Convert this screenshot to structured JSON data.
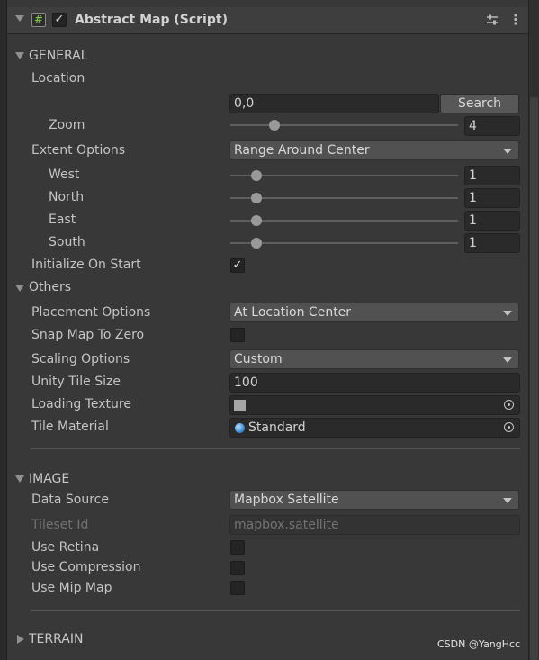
{
  "header": {
    "title": "Abstract Map (Script)",
    "script_icon": "#",
    "enabled_check": "✓",
    "icons": [
      "fold-down-icon",
      "script-icon",
      "presets-icon",
      "kebab-menu-icon"
    ]
  },
  "general": {
    "title": "GENERAL",
    "location_label": "Location",
    "location_value": "0,0",
    "search_label": "Search",
    "zoom_label": "Zoom",
    "zoom_value": "4",
    "extent_label": "Extent Options",
    "extent_value": "Range Around Center",
    "extent_fields": [
      {
        "label": "West",
        "value": "1"
      },
      {
        "label": "North",
        "value": "1"
      },
      {
        "label": "East",
        "value": "1"
      },
      {
        "label": "South",
        "value": "1"
      }
    ],
    "init_label": "Initialize On Start",
    "init_check": "✓"
  },
  "others": {
    "title": "Others",
    "placement_label": "Placement Options",
    "placement_value": "At Location Center",
    "snap_label": "Snap Map To Zero",
    "scaling_label": "Scaling Options",
    "scaling_value": "Custom",
    "tile_size_label": "Unity Tile Size",
    "tile_size_value": "100",
    "loading_texture_label": "Loading Texture",
    "tile_material_label": "Tile Material",
    "tile_material_value": "Standard"
  },
  "image": {
    "title": "IMAGE",
    "data_source_label": "Data Source",
    "data_source_value": "Mapbox Satellite",
    "tileset_label": "Tileset Id",
    "tileset_value": "mapbox.satellite",
    "retina_label": "Use Retina",
    "compression_label": "Use Compression",
    "mipmap_label": "Use Mip Map"
  },
  "terrain": {
    "title": "TERRAIN"
  },
  "watermark": "CSDN @YangHcc",
  "colors": {
    "background": "#383838",
    "field": "#2a2a2a",
    "dropdown": "#515151",
    "text": "#c4c4c4"
  }
}
